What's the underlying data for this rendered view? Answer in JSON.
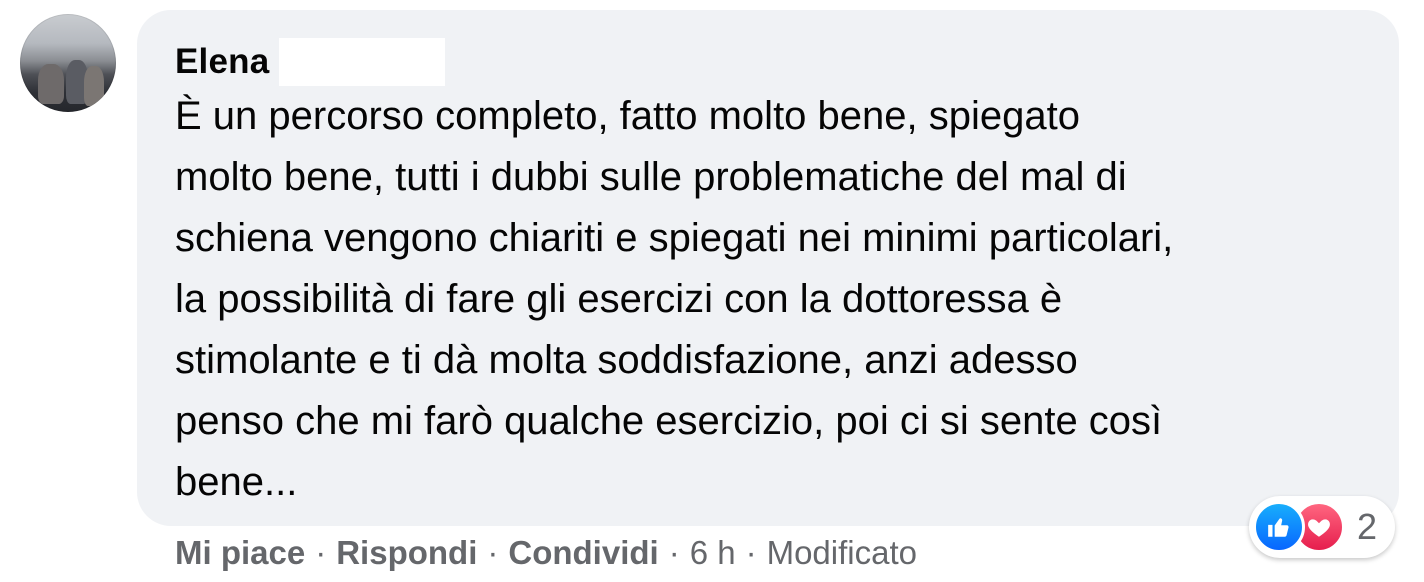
{
  "comment": {
    "author": "Elena",
    "text": "È un percorso completo, fatto molto bene, spiegato\nmolto bene, tutti i dubbi sulle problematiche del mal di\nschiena vengono chiariti e spiegati nei minimi particolari,\nla possibilità di fare gli esercizi con la dottoressa è\nstimolante e ti dà molta soddisfazione, anzi adesso\npenso che mi farò qualche esercizio, poi ci si sente così\nbene..."
  },
  "reactions": {
    "icons": [
      "like-icon",
      "love-icon"
    ],
    "count": "2"
  },
  "actions": {
    "like": "Mi piace",
    "reply": "Rispondi",
    "share": "Condividi",
    "separator": "·",
    "time": "6 h",
    "edited": "Modificato"
  },
  "colors": {
    "bubble": "#f0f2f5",
    "text": "#050505",
    "secondary_text": "#65676b",
    "like_blue": "#0866ff",
    "love_red": "#e61e4d"
  }
}
